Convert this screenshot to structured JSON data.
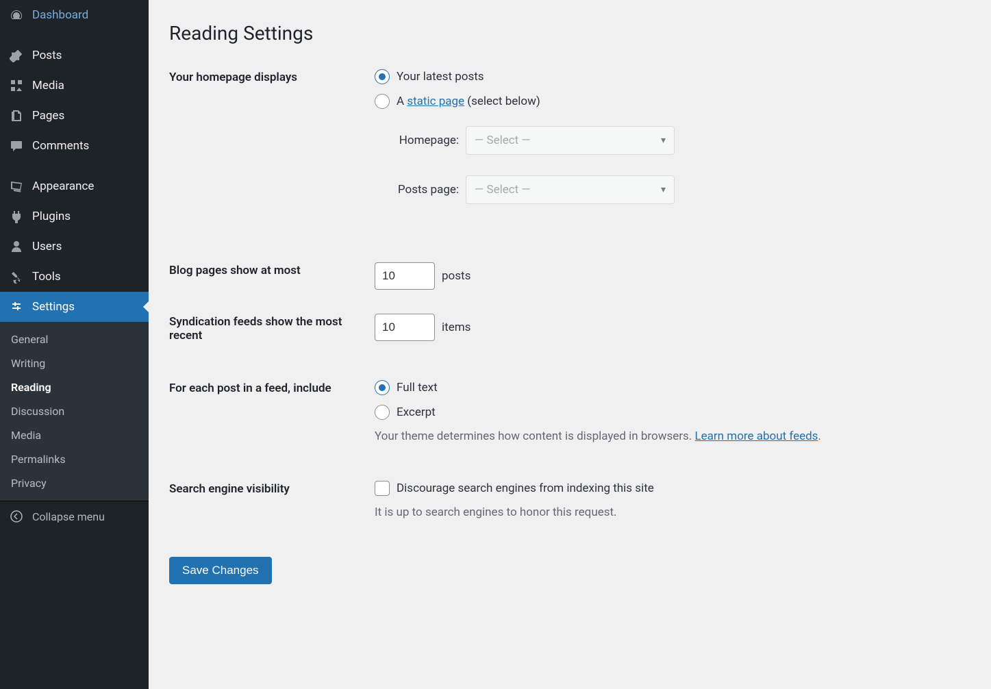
{
  "page_title": "Reading Settings",
  "sidebar": {
    "items": [
      {
        "label": "Dashboard",
        "icon": "dashboard"
      },
      {
        "label": "Posts",
        "icon": "pin"
      },
      {
        "label": "Media",
        "icon": "media"
      },
      {
        "label": "Pages",
        "icon": "pages"
      },
      {
        "label": "Comments",
        "icon": "comments"
      },
      {
        "label": "Appearance",
        "icon": "appearance"
      },
      {
        "label": "Plugins",
        "icon": "plugins"
      },
      {
        "label": "Users",
        "icon": "users"
      },
      {
        "label": "Tools",
        "icon": "tools"
      },
      {
        "label": "Settings",
        "icon": "settings",
        "active": true
      }
    ],
    "submenu": [
      {
        "label": "General"
      },
      {
        "label": "Writing"
      },
      {
        "label": "Reading",
        "current": true
      },
      {
        "label": "Discussion"
      },
      {
        "label": "Media"
      },
      {
        "label": "Permalinks"
      },
      {
        "label": "Privacy"
      }
    ],
    "collapse_label": "Collapse menu"
  },
  "homepage": {
    "label": "Your homepage displays",
    "option_latest": "Your latest posts",
    "option_static_prefix": "A ",
    "option_static_link": "static page",
    "option_static_suffix": " (select below)",
    "homepage_label": "Homepage:",
    "posts_page_label": "Posts page:",
    "select_placeholder": "— Select —"
  },
  "blog_pages": {
    "label": "Blog pages show at most",
    "value": "10",
    "unit": "posts"
  },
  "syndication": {
    "label": "Syndication feeds show the most recent",
    "value": "10",
    "unit": "items"
  },
  "feed_content": {
    "label": "For each post in a feed, include",
    "option_full": "Full text",
    "option_excerpt": "Excerpt",
    "description_prefix": "Your theme determines how content is displayed in browsers. ",
    "description_link": "Learn more about feeds",
    "description_suffix": "."
  },
  "search_visibility": {
    "label": "Search engine visibility",
    "checkbox_label": "Discourage search engines from indexing this site",
    "description": "It is up to search engines to honor this request."
  },
  "submit_label": "Save Changes"
}
